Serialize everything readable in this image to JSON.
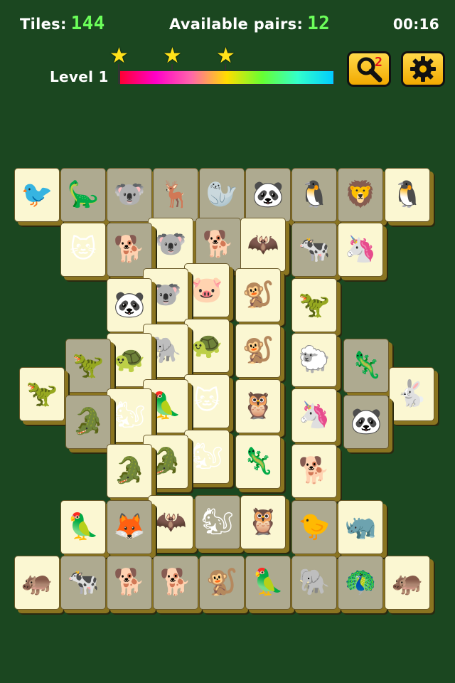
{
  "hud": {
    "tiles_label": "Tiles:",
    "tiles_value": "144",
    "pairs_label": "Available pairs:",
    "pairs_value": "12",
    "timer": "00:16",
    "level_label": "Level 1",
    "progress": 1.0,
    "stars": 3,
    "hint_count": "2"
  },
  "colors": {
    "background": "#1b4720",
    "tile_free": "#fbf7d2",
    "tile_blocked": "#aeaa90",
    "accent_button": "#f5b800",
    "number": "#6cff5a"
  },
  "icons": {
    "hint": "magnifier-icon",
    "settings": "gear-icon",
    "star": "star-icon"
  },
  "tiles": [
    {
      "animal": "pelican",
      "glyph": "🐦",
      "state": "free"
    },
    {
      "animal": "stegosaurus",
      "glyph": "🦕",
      "state": "blocked"
    },
    {
      "animal": "koala",
      "glyph": "🐨",
      "state": "blocked"
    },
    {
      "animal": "reindeer",
      "glyph": "🦌",
      "state": "blocked"
    },
    {
      "animal": "seal",
      "glyph": "🦭",
      "state": "blocked"
    },
    {
      "animal": "panda",
      "glyph": "🐼",
      "state": "blocked"
    },
    {
      "animal": "penguin",
      "glyph": "🐧",
      "state": "blocked"
    },
    {
      "animal": "lion",
      "glyph": "🦁",
      "state": "blocked"
    },
    {
      "animal": "penguin",
      "glyph": "🐧",
      "state": "free"
    },
    {
      "animal": "cat",
      "glyph": "🐱",
      "state": "free"
    },
    {
      "animal": "dog",
      "glyph": "🐕",
      "state": "blocked"
    },
    {
      "animal": "koala",
      "glyph": "🐨",
      "state": "free"
    },
    {
      "animal": "dog",
      "glyph": "🐕",
      "state": "blocked"
    },
    {
      "animal": "bat",
      "glyph": "🦇",
      "state": "free"
    },
    {
      "animal": "cow",
      "glyph": "🐄",
      "state": "blocked"
    },
    {
      "animal": "unicorn",
      "glyph": "🦄",
      "state": "free"
    },
    {
      "animal": "panda",
      "glyph": "🐼",
      "state": "free"
    },
    {
      "animal": "koala",
      "glyph": "🐨",
      "state": "free"
    },
    {
      "animal": "pig",
      "glyph": "🐷",
      "state": "free"
    },
    {
      "animal": "monkey",
      "glyph": "🐒",
      "state": "free"
    },
    {
      "animal": "triceratops",
      "glyph": "🦖",
      "state": "free"
    },
    {
      "animal": "triceratops",
      "glyph": "🦖",
      "state": "blocked"
    },
    {
      "animal": "turtle",
      "glyph": "🐢",
      "state": "free"
    },
    {
      "animal": "elephant",
      "glyph": "🐘",
      "state": "free"
    },
    {
      "animal": "turtle",
      "glyph": "🐢",
      "state": "free"
    },
    {
      "animal": "monkey",
      "glyph": "🐒",
      "state": "free"
    },
    {
      "animal": "sheep",
      "glyph": "🐑",
      "state": "free"
    },
    {
      "animal": "chameleon",
      "glyph": "🦎",
      "state": "blocked"
    },
    {
      "animal": "triceratops",
      "glyph": "🦖",
      "state": "free"
    },
    {
      "animal": "rabbit",
      "glyph": "🐇",
      "state": "free"
    },
    {
      "animal": "crocodile",
      "glyph": "🐊",
      "state": "blocked"
    },
    {
      "animal": "squirrel",
      "glyph": "🐿",
      "state": "free"
    },
    {
      "animal": "parrot",
      "glyph": "🦜",
      "state": "free"
    },
    {
      "animal": "cat",
      "glyph": "🐱",
      "state": "free"
    },
    {
      "animal": "owl",
      "glyph": "🦉",
      "state": "free"
    },
    {
      "animal": "unicorn",
      "glyph": "🦄",
      "state": "free"
    },
    {
      "animal": "panda",
      "glyph": "🐼",
      "state": "blocked"
    },
    {
      "animal": "crocodile",
      "glyph": "🐊",
      "state": "free"
    },
    {
      "animal": "crocodile",
      "glyph": "🐊",
      "state": "free"
    },
    {
      "animal": "squirrel",
      "glyph": "🐿",
      "state": "free"
    },
    {
      "animal": "chameleon",
      "glyph": "🦎",
      "state": "free"
    },
    {
      "animal": "dog",
      "glyph": "🐕",
      "state": "free"
    },
    {
      "animal": "parrot",
      "glyph": "🦜",
      "state": "free"
    },
    {
      "animal": "fox",
      "glyph": "🦊",
      "state": "blocked"
    },
    {
      "animal": "bat",
      "glyph": "🦇",
      "state": "free"
    },
    {
      "animal": "squirrel",
      "glyph": "🐿",
      "state": "blocked"
    },
    {
      "animal": "owl",
      "glyph": "🦉",
      "state": "free"
    },
    {
      "animal": "chick",
      "glyph": "🐤",
      "state": "blocked"
    },
    {
      "animal": "rhino",
      "glyph": "🦏",
      "state": "free"
    },
    {
      "animal": "hippo",
      "glyph": "🦛",
      "state": "free"
    },
    {
      "animal": "cow",
      "glyph": "🐄",
      "state": "blocked"
    },
    {
      "animal": "dog",
      "glyph": "🐕",
      "state": "blocked"
    },
    {
      "animal": "dog",
      "glyph": "🐕",
      "state": "blocked"
    },
    {
      "animal": "monkey",
      "glyph": "🐒",
      "state": "blocked"
    },
    {
      "animal": "parrot",
      "glyph": "🦜",
      "state": "blocked"
    },
    {
      "animal": "elephant",
      "glyph": "🐘",
      "state": "blocked"
    },
    {
      "animal": "peacock",
      "glyph": "🦚",
      "state": "blocked"
    },
    {
      "animal": "hippo",
      "glyph": "🦛",
      "state": "free"
    }
  ]
}
